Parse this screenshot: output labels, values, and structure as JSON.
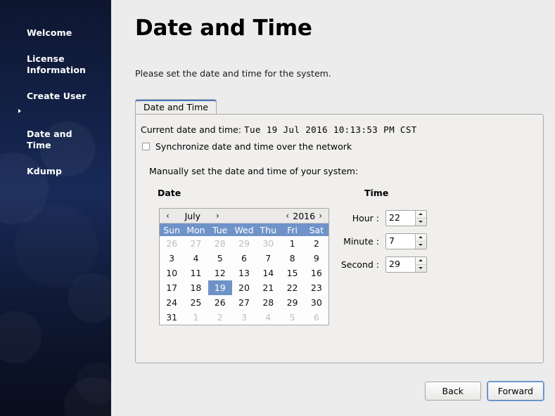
{
  "sidebar": {
    "items": [
      {
        "label": "Welcome",
        "current": false
      },
      {
        "label": "License\nInformation",
        "current": false
      },
      {
        "label": "Create User",
        "current": false
      },
      {
        "label": "Date and\nTime",
        "current": true
      },
      {
        "label": "Kdump",
        "current": false
      }
    ]
  },
  "main": {
    "title": "Date and Time",
    "subtitle": "Please set the date and time for the system.",
    "tab_label": "Date and Time",
    "current_label": "Current date and time:",
    "current_value": "Tue 19 Jul 2016 10:13:53 PM CST",
    "sync_checkbox_label": "Synchronize date and time over the network",
    "sync_checkbox_checked": false,
    "manual_label": "Manually set the date and time of your system:",
    "date_heading": "Date",
    "time_heading": "Time"
  },
  "calendar": {
    "prev_month_icon": "‹",
    "next_month_icon": "›",
    "prev_year_icon": "‹",
    "next_year_icon": "›",
    "month": "July",
    "year": "2016",
    "weekdays": [
      "Sun",
      "Mon",
      "Tue",
      "Wed",
      "Thu",
      "Fri",
      "Sat"
    ],
    "header_color": "#6f93c8",
    "selected_day": 19,
    "weeks": [
      [
        {
          "d": "26",
          "dim": true
        },
        {
          "d": "27",
          "dim": true
        },
        {
          "d": "28",
          "dim": true
        },
        {
          "d": "29",
          "dim": true
        },
        {
          "d": "30",
          "dim": true
        },
        {
          "d": "1",
          "dim": false
        },
        {
          "d": "2",
          "dim": false
        }
      ],
      [
        {
          "d": "3",
          "dim": false
        },
        {
          "d": "4",
          "dim": false
        },
        {
          "d": "5",
          "dim": false
        },
        {
          "d": "6",
          "dim": false
        },
        {
          "d": "7",
          "dim": false
        },
        {
          "d": "8",
          "dim": false
        },
        {
          "d": "9",
          "dim": false
        }
      ],
      [
        {
          "d": "10",
          "dim": false
        },
        {
          "d": "11",
          "dim": false
        },
        {
          "d": "12",
          "dim": false
        },
        {
          "d": "13",
          "dim": false
        },
        {
          "d": "14",
          "dim": false
        },
        {
          "d": "15",
          "dim": false
        },
        {
          "d": "16",
          "dim": false
        }
      ],
      [
        {
          "d": "17",
          "dim": false
        },
        {
          "d": "18",
          "dim": false
        },
        {
          "d": "19",
          "dim": false,
          "selected": true
        },
        {
          "d": "20",
          "dim": false
        },
        {
          "d": "21",
          "dim": false
        },
        {
          "d": "22",
          "dim": false
        },
        {
          "d": "23",
          "dim": false
        }
      ],
      [
        {
          "d": "24",
          "dim": false
        },
        {
          "d": "25",
          "dim": false
        },
        {
          "d": "26",
          "dim": false
        },
        {
          "d": "27",
          "dim": false
        },
        {
          "d": "28",
          "dim": false
        },
        {
          "d": "29",
          "dim": false
        },
        {
          "d": "30",
          "dim": false
        }
      ],
      [
        {
          "d": "31",
          "dim": false
        },
        {
          "d": "1",
          "dim": true
        },
        {
          "d": "2",
          "dim": true
        },
        {
          "d": "3",
          "dim": true
        },
        {
          "d": "4",
          "dim": true
        },
        {
          "d": "5",
          "dim": true
        },
        {
          "d": "6",
          "dim": true
        }
      ]
    ]
  },
  "time": {
    "hour_label": "Hour :",
    "hour_value": "22",
    "minute_label": "Minute :",
    "minute_value": "7",
    "second_label": "Second :",
    "second_value": "29"
  },
  "footer": {
    "back_label": "Back",
    "forward_label": "Forward"
  }
}
